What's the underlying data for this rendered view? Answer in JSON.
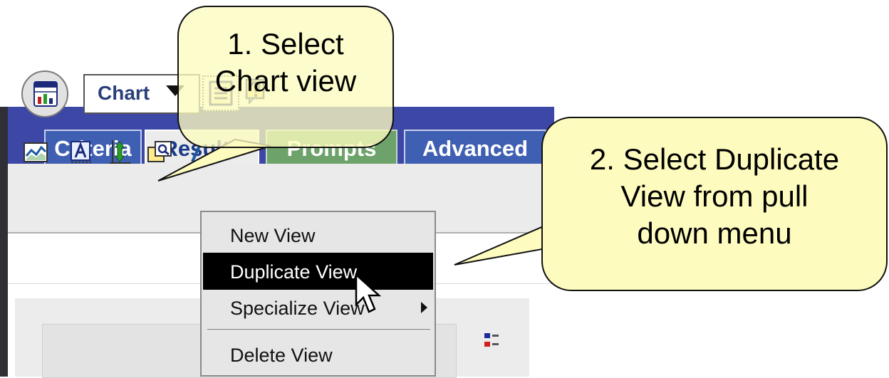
{
  "tabs": [
    {
      "label": "Criteria",
      "style": "blue"
    },
    {
      "label": "Results",
      "style": "active"
    },
    {
      "label": "Prompts",
      "style": "green"
    },
    {
      "label": "Advanced",
      "style": "blue"
    }
  ],
  "view_selector": {
    "selected": "Chart",
    "icon": "chart-view-icon"
  },
  "toolbar_icons": [
    "properties-icon",
    "help-icon"
  ],
  "chart_toolbar_icons": [
    "line-chart-icon",
    "format-icon",
    "axis-scale-icon",
    "zoom-icon"
  ],
  "context_menu": {
    "items": [
      {
        "label": "New View",
        "highlighted": false,
        "has_submenu": false
      },
      {
        "label": "Duplicate View",
        "highlighted": true,
        "has_submenu": false
      },
      {
        "label": "Specialize View",
        "highlighted": false,
        "has_submenu": true
      },
      {
        "label": "Delete View",
        "highlighted": false,
        "has_submenu": false
      }
    ]
  },
  "callouts": {
    "step1": {
      "line1": "1. Select",
      "line2": "Chart view"
    },
    "step2": {
      "line1": "2. Select Duplicate",
      "line2": "View from pull",
      "line3": "down menu"
    }
  },
  "colors": {
    "tabbar": "#3d47a6",
    "tab_blue": "#3f5fb2",
    "tab_green": "#6da36a",
    "callout_fill": "#fdfbbe",
    "menu_highlight": "#000000"
  }
}
